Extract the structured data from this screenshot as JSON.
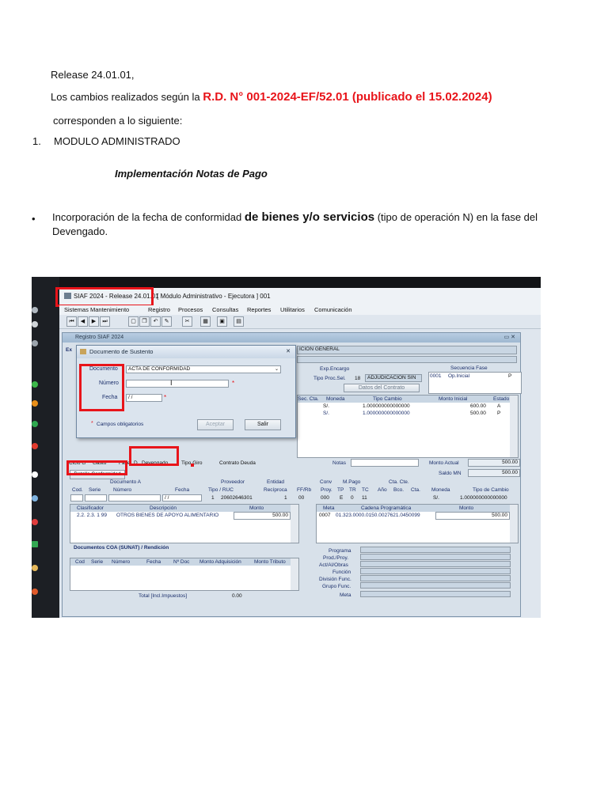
{
  "doc": {
    "release": "Release 24.01.01,",
    "changes_prefix": "Los cambios realizados según la ",
    "rd_ref": "R.D. N° 001-2024-EF/52.01 (publicado el 15.02.2024)",
    "correspond": "corresponden a lo siguiente:",
    "list_num": "1.",
    "list_title": "MODULO ADMINISTRADO",
    "subtitle": "Implementación Notas de Pago",
    "bullet_symbol": "•",
    "bullet_a": "Incorporación de la fecha de conformidad ",
    "bullet_b": "de bienes y/o servicios",
    "bullet_c": " (tipo de operación N) en la fase del",
    "bullet_d": "Devengado."
  },
  "app": {
    "title": "SIAF 2024 - Release 24.01.01",
    "title_suffix": "[ Módulo Administrativo - Ejecutora ] 001",
    "menu": [
      "Sistemas",
      "Mantenimiento",
      "Registro",
      "Procesos",
      "Consultas",
      "Reportes",
      "Utilitarios",
      "Comunicación"
    ],
    "registro_title": "Registro SIAF 2024",
    "exp_label": "Ex",
    "header_right": "ICION GENERAL",
    "exp_encargo": "Exp.Encargo",
    "secuencia_fase": "Secuencia Fase",
    "tipo_proc_sel": "Tipo Proc.Sel.",
    "tipo_proc_num": "18",
    "adjudicacion": "ADJUDICACION SIN",
    "secuencia_row": "0001",
    "op_inicial": "Op.Inicial",
    "p_flag": "P",
    "datos_contrato": "Datos del Contrato",
    "cols_top": [
      "Sec. Cta.",
      "Moneda",
      "Tipo Cambio",
      "Monto Inicial",
      "Estado"
    ],
    "rows_top": [
      {
        "moneda": "S/.",
        "tc": "1.000000000000000",
        "monto": "600.00",
        "estado": "A"
      },
      {
        "moneda": "S/.",
        "tc": "1.000000000000000",
        "monto": "500.00",
        "estado": "P"
      }
    ],
    "ciclo": "Ciclo G",
    "gasto": "Gasto",
    "fase": "Fase",
    "fase_code": "D",
    "devengado": "Devengado",
    "tipo_giro": "Tipo Giro",
    "contrato_deuda": "Contrato Deuda",
    "notas": "Notas",
    "monto_actual_label": "Monto Actual",
    "monto_actual": "500.00",
    "saldo_mn_label": "Saldo MN",
    "saldo_mn": "500.00",
    "detalle_conformidad": "Detalle Conformidad",
    "documento_a": "Documento A",
    "doc_cols": [
      "Cod.",
      "Serie",
      "Número",
      "Fecha"
    ],
    "proveedor": "Proveedor",
    "tipo_ruc": "Tipo / RUC",
    "prov_tipo": "1",
    "prov_ruc": "20602646301",
    "entidad": "Entidad",
    "reciproca": "Recíproca",
    "reciproca_val": "1",
    "ff_rb": "FF/Rb",
    "ff_val": "00",
    "conv": "Conv",
    "proy": "Proy.",
    "proy_val": "000",
    "m_pago": "M.Pago",
    "tp_tr_tc": [
      "TP",
      "TR",
      "TC"
    ],
    "tp_vals": [
      "E",
      "0",
      "11"
    ],
    "cta_cte": "Cta. Cte.",
    "cta_cols": [
      "Año",
      "Bco.",
      "Cta."
    ],
    "moneda": "Moneda",
    "moneda_val": "S/.",
    "tipo_cambio": "Tipo de Cambio",
    "tipo_cambio_val": "1.000000000000000",
    "clasificador": "Clasificador",
    "descripcion": "Descripción",
    "monto": "Monto",
    "clasif_code": "2.2. 2.3. 1 99",
    "clasif_desc": "OTROS BIENES DE APOYO ALIMENTARIO",
    "clasif_monto": "500.00",
    "meta": "Meta",
    "cadena": "Cadena Programática",
    "meta_code": "0007",
    "cadena_val": "01.323.0000.0150.0027621.0450099",
    "meta_monto": "500.00",
    "coa_title": "Documentos COA (SUNAT) / Rendición",
    "coa_cols": [
      "Cod",
      "Serie",
      "Número",
      "Fecha",
      "Nº Doc",
      "Monto Adquisición",
      "Monto Tributo"
    ],
    "total_label": "Total [Incl.Impuestos]",
    "total_val": "0.00",
    "prog_labels": [
      "Programa",
      "Prod./Proy.",
      "Act/AI/Obras",
      "Función",
      "División Func.",
      "Grupo Func.",
      "Meta"
    ]
  },
  "dialog": {
    "title": "Documento de Sustento",
    "close": "✕",
    "documento_label": "Documento",
    "documento_value": "ACTA DE CONFORMIDAD",
    "numero_label": "Número",
    "fecha_label": "Fecha",
    "fecha_value": "/ /",
    "required_mark": "*",
    "campos_obligatorios": "Campos obligatorios",
    "aceptar": "Aceptar",
    "salir": "Salir"
  },
  "colors": {
    "red": "#e8141a",
    "title_blue": "#1b2f6b"
  }
}
